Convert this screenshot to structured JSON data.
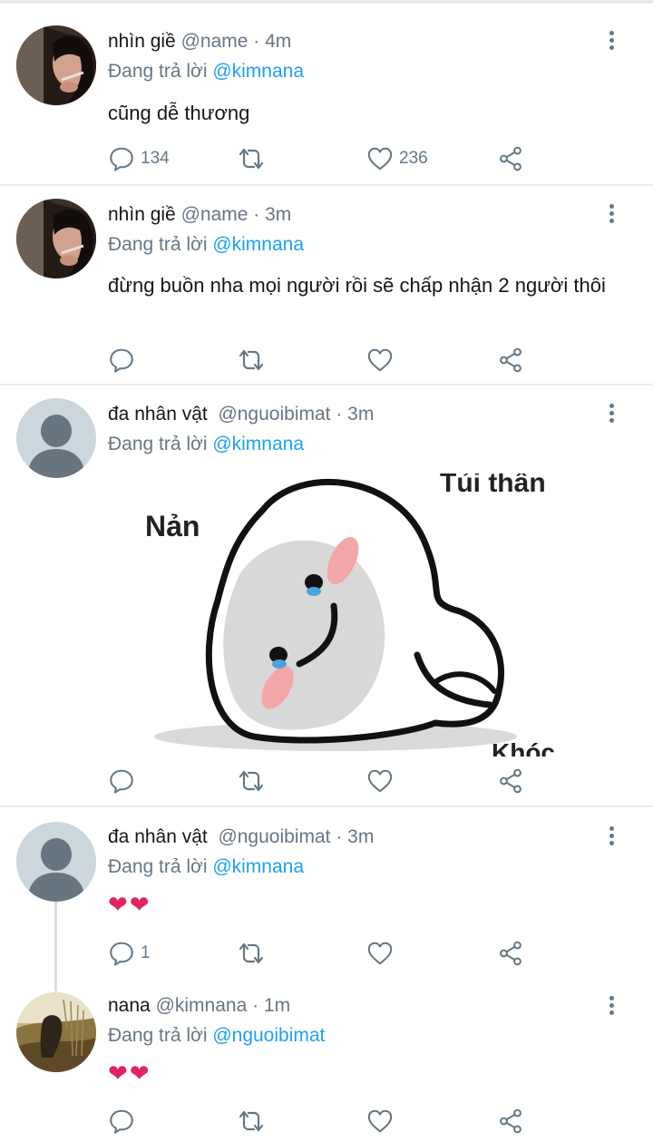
{
  "colors": {
    "accent": "#1da1f2",
    "muted": "#687684",
    "text": "#14171a",
    "heart": "#e0245e"
  },
  "tweets": [
    {
      "name": "nhìn giề",
      "handle": "@name",
      "time": "· 4m",
      "reply_prefix": "Đang trả lời",
      "reply_to": "@kimnana",
      "text": "cũng dễ thương",
      "reply_count": "134",
      "like_count": "236"
    },
    {
      "name": "nhìn giề",
      "handle": "@name",
      "time": "· 3m",
      "reply_prefix": "Đang trả lời",
      "reply_to": "@kimnana",
      "text": "đừng buồn nha mọi người rồi sẽ chấp nhận 2 người thôi"
    },
    {
      "name": "đa nhân vật",
      "handle": "@nguoibimat",
      "time": "· 3m",
      "reply_prefix": "Đang trả lời",
      "reply_to": "@kimnana",
      "image_text": {
        "left": "Nản",
        "top": "Tủi thân",
        "bottom": "Khóc"
      }
    },
    {
      "name": "đa nhân vật",
      "handle": "@nguoibimat",
      "time": "· 3m",
      "reply_prefix": "Đang trả lời",
      "reply_to": "@kimnana",
      "text": "❤❤",
      "reply_count": "1"
    },
    {
      "name": "nana",
      "handle": "@kimnana",
      "time": "· 1m",
      "reply_prefix": "Đang trả lời",
      "reply_to": "@nguoibimat",
      "text": "❤❤"
    }
  ],
  "icons": {
    "reply": "comment-icon",
    "retweet": "retweet-icon",
    "like": "heart-icon",
    "share": "share-icon",
    "more": "more-vertical-icon"
  }
}
